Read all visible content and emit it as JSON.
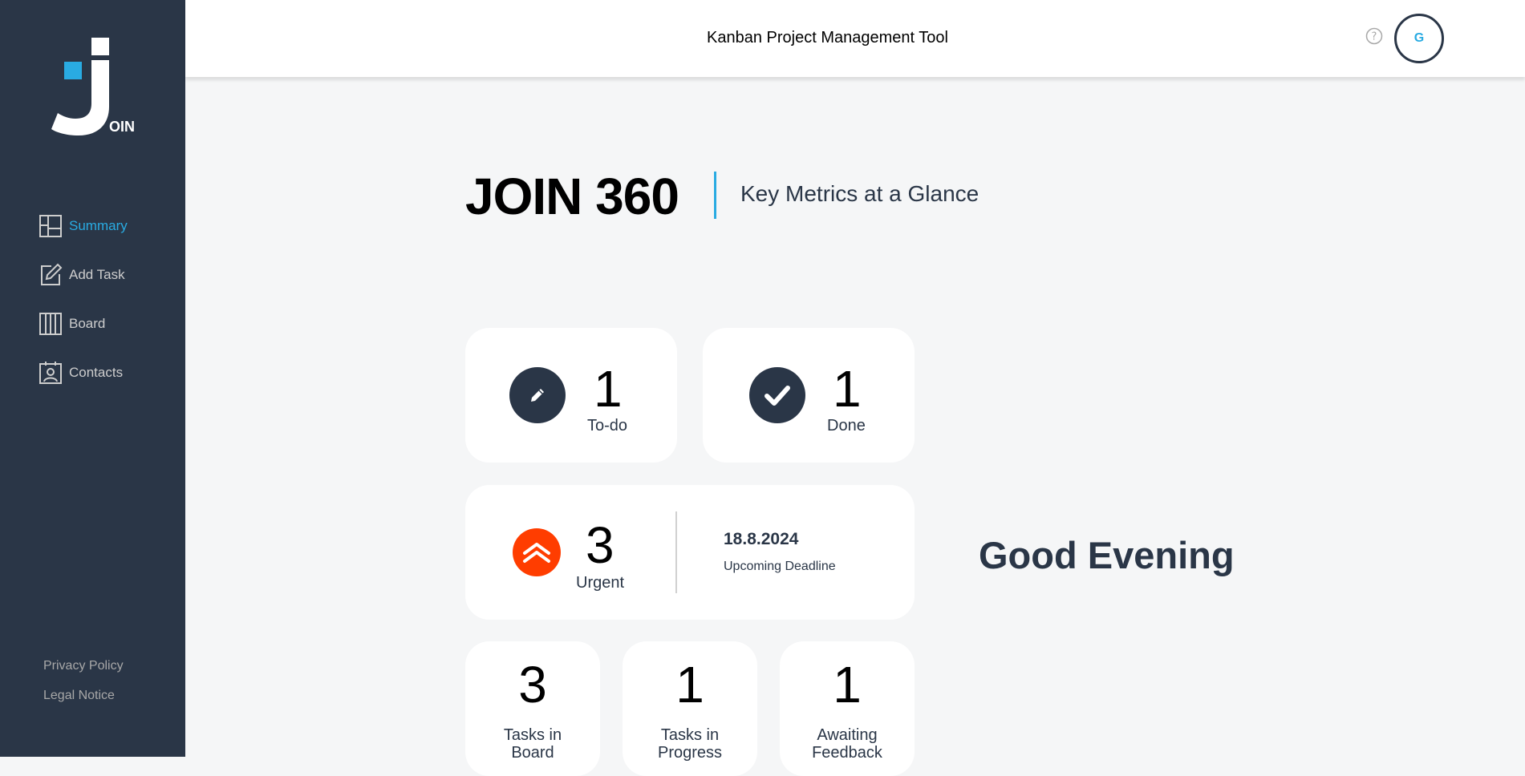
{
  "header": {
    "title": "Kanban Project Management Tool",
    "avatar_initial": "G",
    "help_icon": "help-circle-icon"
  },
  "sidebar": {
    "logo_text": "OIN",
    "items": [
      {
        "label": "Summary",
        "icon": "summary-icon",
        "active": true
      },
      {
        "label": "Add Task",
        "icon": "add-task-icon",
        "active": false
      },
      {
        "label": "Board",
        "icon": "board-icon",
        "active": false
      },
      {
        "label": "Contacts",
        "icon": "contacts-icon",
        "active": false
      }
    ],
    "footer": {
      "privacy": "Privacy Policy",
      "legal": "Legal Notice"
    }
  },
  "main": {
    "title": "JOIN 360",
    "subtitle": "Key Metrics at a Glance",
    "todo": {
      "count": "1",
      "label": "To-do"
    },
    "done": {
      "count": "1",
      "label": "Done"
    },
    "urgent": {
      "count": "3",
      "label": "Urgent",
      "deadline_date": "18.8.2024",
      "deadline_label": "Upcoming Deadline"
    },
    "board_tasks": {
      "count": "3",
      "label": "Tasks in Board"
    },
    "in_progress": {
      "count": "1",
      "label": "Tasks in Progress"
    },
    "feedback": {
      "count": "1",
      "label": "Awaiting Feedback"
    },
    "greeting": "Good Evening"
  },
  "colors": {
    "sidebar_bg": "#2a3647",
    "accent": "#29abe2",
    "urgent": "#ff3d00"
  }
}
